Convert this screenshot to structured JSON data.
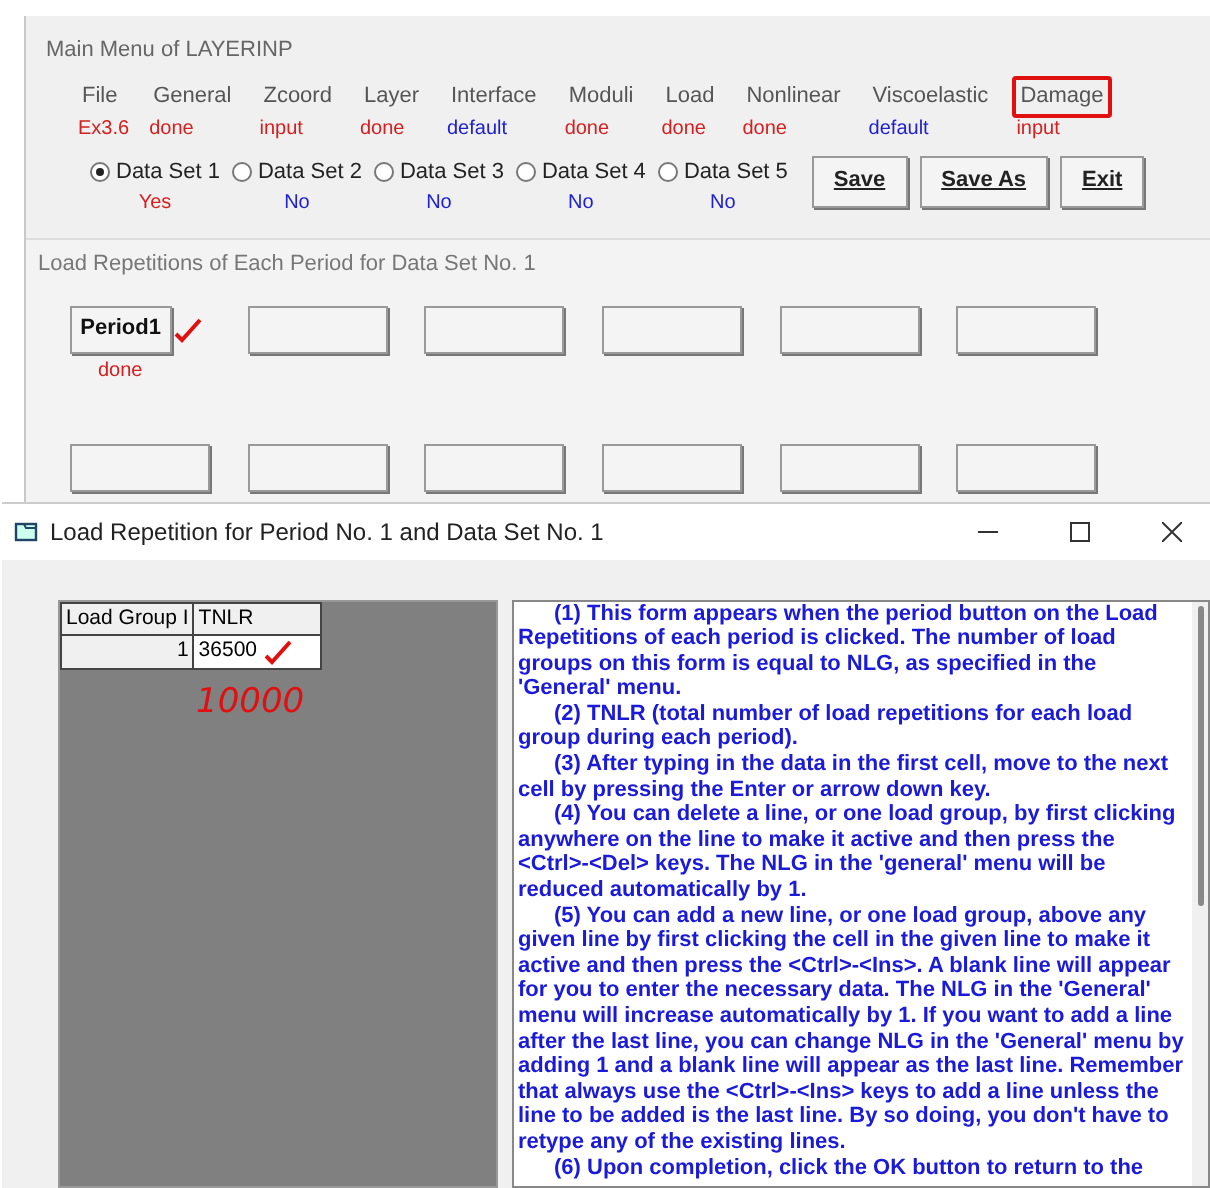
{
  "main_window": {
    "title": "Main Menu of LAYERINP"
  },
  "menu": [
    {
      "label": "File",
      "status": "Ex3.6",
      "color": "#d42020",
      "circled": false
    },
    {
      "label": "General",
      "status": "done",
      "color": "#d42020",
      "circled": false
    },
    {
      "label": "Zcoord",
      "status": "input",
      "color": "#d42020",
      "circled": false
    },
    {
      "label": "Layer",
      "status": "done",
      "color": "#d42020",
      "circled": false
    },
    {
      "label": "Interface",
      "status": "default",
      "color": "#2020d0",
      "circled": false
    },
    {
      "label": "Moduli",
      "status": "done",
      "color": "#d42020",
      "circled": false
    },
    {
      "label": "Load",
      "status": "done",
      "color": "#d42020",
      "circled": false
    },
    {
      "label": "Nonlinear",
      "status": "done",
      "color": "#d42020",
      "circled": false
    },
    {
      "label": "Viscoelastic",
      "status": "default",
      "color": "#2020d0",
      "circled": false
    },
    {
      "label": "Damage",
      "status": "input",
      "color": "#d42020",
      "circled": true
    }
  ],
  "data_sets": [
    {
      "label": "Data Set 1",
      "status": "Yes",
      "color": "#d42020",
      "selected": true
    },
    {
      "label": "Data Set 2",
      "status": "No",
      "color": "#2020d0",
      "selected": false
    },
    {
      "label": "Data Set 3",
      "status": "No",
      "color": "#2020d0",
      "selected": false
    },
    {
      "label": "Data Set 4",
      "status": "No",
      "color": "#2020d0",
      "selected": false
    },
    {
      "label": "Data Set 5",
      "status": "No",
      "color": "#2020d0",
      "selected": false
    }
  ],
  "buttons": [
    {
      "label": "Save"
    },
    {
      "label": "Save As"
    },
    {
      "label": "Exit"
    }
  ],
  "section": {
    "title": "Load Repetitions of Each Period for Data Set No.  1"
  },
  "periods": [
    {
      "kind": "labeled",
      "label": "Period1",
      "status": "done",
      "checked": true
    },
    {
      "kind": "blank"
    },
    {
      "kind": "blank"
    },
    {
      "kind": "blank"
    },
    {
      "kind": "blank"
    },
    {
      "kind": "blank"
    },
    {
      "kind": "blank"
    },
    {
      "kind": "blank"
    },
    {
      "kind": "blank"
    },
    {
      "kind": "blank"
    },
    {
      "kind": "blank"
    },
    {
      "kind": "blank"
    }
  ],
  "dialog": {
    "title": "Load Repetition for Period No. 1 and Data Set No. 1",
    "table": {
      "columns": [
        "Load Group I",
        "TNLR"
      ],
      "rows": [
        {
          "cells": [
            "1",
            "36500"
          ],
          "checked": true
        }
      ]
    },
    "note": "10000",
    "help": [
      "(1)  This form appears when the period button on the Load Repetitions of each period is clicked.  The number of load groups on this form is equal to NLG, as specified in the 'General' menu.",
      "(2)  TNLR (total number of load repetitions for each load group during each period).",
      "(3)  After typing in the data in the first cell, move to the next cell by pressing the Enter or arrow down key.",
      "(4)  You can delete a line, or one load group, by first clicking anywhere on the line to make it active and then press the <Ctrl>-<Del> keys.  The NLG in the 'general' menu will be reduced automatically by 1.",
      "(5) You can add a new line, or one load group, above any given line by first clicking the cell in the given line to make it active and then press the <Ctrl>-<Ins>.  A blank line will appear for you to enter the necessary data.  The NLG in the 'General' menu will increase automatically by 1.  If you want to add a line after the last line, you can change NLG in the 'General' menu by adding 1 and a blank line will appear as the last line.  Remember that always use the <Ctrl>-<Ins> keys to add a line unless the line to be added is the last line.  By so doing, you don't have to retype any of the existing lines.",
      "(6)  Upon completion, click the OK button to return to the"
    ]
  }
}
